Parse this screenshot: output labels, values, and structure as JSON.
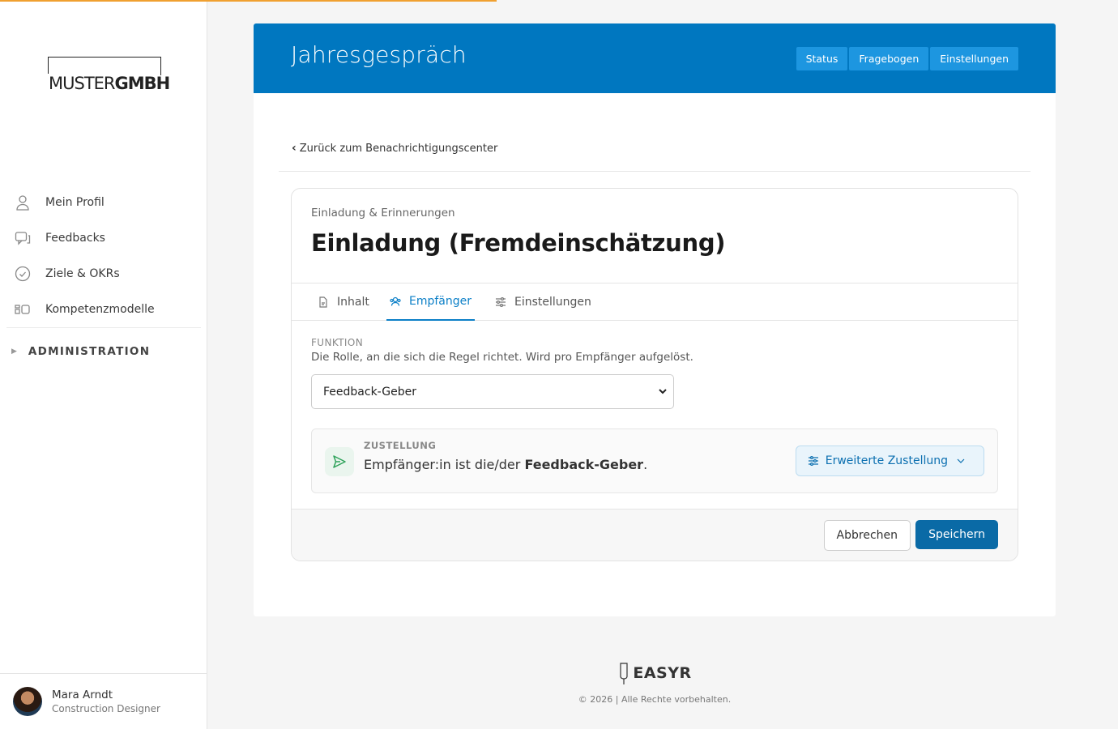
{
  "logo": {
    "part1": "MUSTER",
    "part2": "GMBH"
  },
  "nav": {
    "items": [
      {
        "label": "Mein Profil",
        "icon": "user-icon"
      },
      {
        "label": "Feedbacks",
        "icon": "chat-icon"
      },
      {
        "label": "Ziele & OKRs",
        "icon": "check-circle-icon"
      },
      {
        "label": "Kompetenzmodelle",
        "icon": "blocks-icon"
      }
    ],
    "admin_label": "ADMINISTRATION"
  },
  "user": {
    "name": "Mara Arndt",
    "role": "Construction Designer"
  },
  "header": {
    "title": "Jahresgespräch",
    "buttons": [
      "Status",
      "Fragebogen",
      "Einstellungen"
    ]
  },
  "back_link": "Zurück zum Benachrichtigungscenter",
  "panel": {
    "subtitle": "Einladung & Erinnerungen",
    "title": "Einladung (Fremdeinschätzung)",
    "tabs": [
      {
        "label": "Inhalt",
        "icon": "document-icon"
      },
      {
        "label": "Empfänger",
        "icon": "users-icon"
      },
      {
        "label": "Einstellungen",
        "icon": "sliders-icon"
      }
    ],
    "active_tab": "Empfänger",
    "field": {
      "label": "FUNKTION",
      "help": "Die Rolle, an die sich die Regel richtet. Wird pro Empfänger aufgelöst.",
      "selected": "Feedback-Geber"
    },
    "delivery": {
      "label": "ZUSTELLUNG",
      "text_prefix": "Empfänger:in ist die/der ",
      "text_role": "Feedback-Geber",
      "text_suffix": ".",
      "advanced_button": "Erweiterte Zustellung"
    },
    "cancel": "Abbrechen",
    "save": "Speichern"
  },
  "footer": {
    "brand": "EASYR",
    "copyright": "© 2026 | Alle Rechte vorbehalten."
  },
  "colors": {
    "primary": "#0077c0",
    "accent_progress": "#f0a030",
    "save": "#0a6aa6"
  }
}
